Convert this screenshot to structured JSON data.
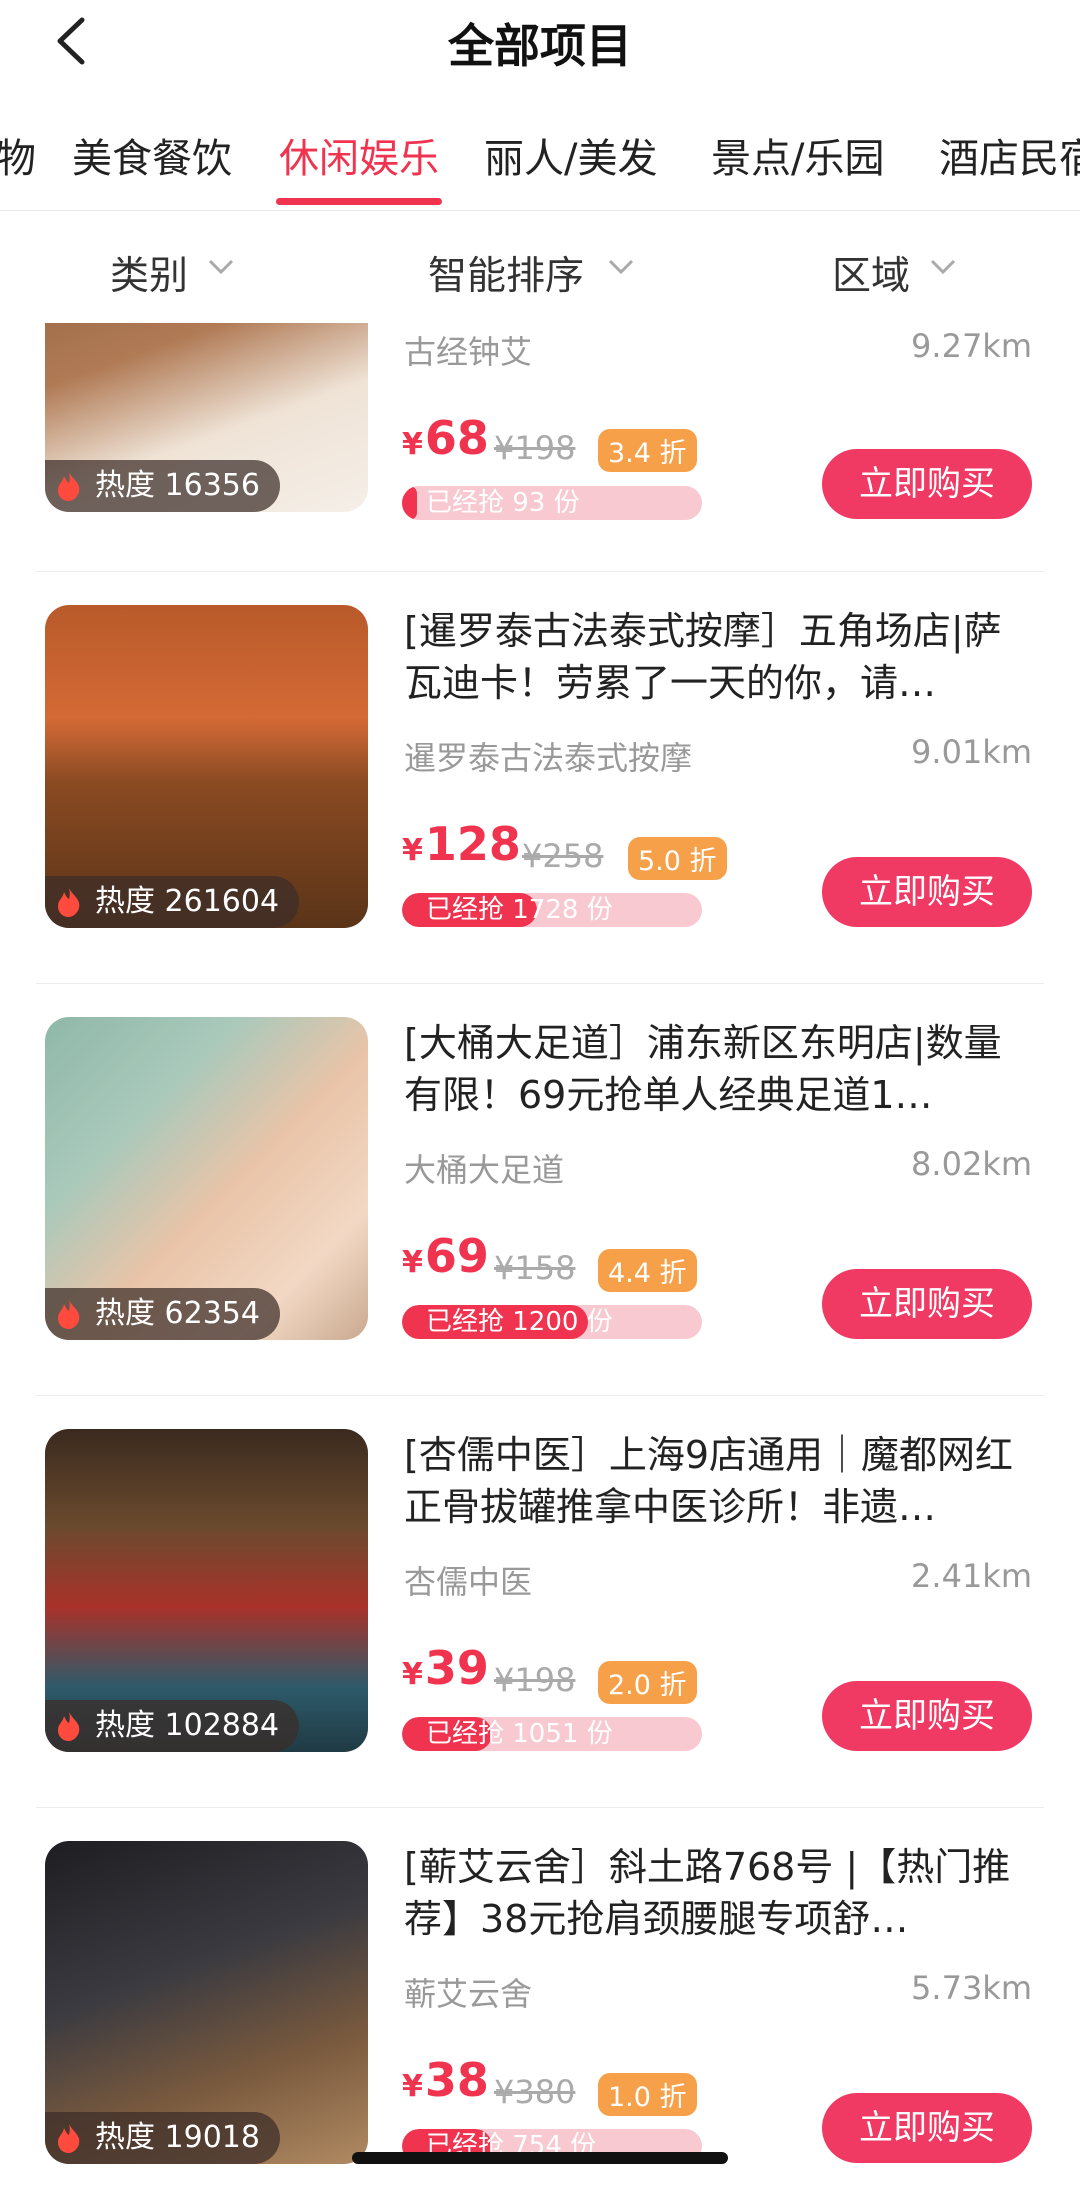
{
  "header": {
    "title": "全部项目"
  },
  "tabs": [
    "物",
    "美食餐饮",
    "休闲娱乐",
    "丽人/美发",
    "景点/乐园",
    "酒店民宿"
  ],
  "active_tab": "休闲娱乐",
  "filters": [
    "类别",
    "智能排序",
    "区域"
  ],
  "items": [
    {
      "title": "",
      "shop": "古经钟艾",
      "distance": "9.27km",
      "price": "68",
      "original": "¥198",
      "discount": "3.4 折",
      "sold": "已经抢 93 份",
      "sold_fraction": 0.05,
      "heat": "热度 16356",
      "buy": "立即购买"
    },
    {
      "title": "[暹罗泰古法泰式按摩］五角场店|萨瓦迪卡！劳累了一天的你，请…",
      "shop": "暹罗泰古法泰式按摩",
      "distance": "9.01km",
      "price": "128",
      "original": "¥258",
      "discount": "5.0 折",
      "sold": "已经抢 1728 份",
      "sold_fraction": 0.45,
      "heat": "热度 261604",
      "buy": "立即购买"
    },
    {
      "title": "[大桶大足道］浦东新区东明店|数量有限！69元抢单人经典足道1…",
      "shop": "大桶大足道",
      "distance": "8.02km",
      "price": "69",
      "original": "¥158",
      "discount": "4.4 折",
      "sold": "已经抢 1200 份",
      "sold_fraction": 0.62,
      "heat": "热度 62354",
      "buy": "立即购买"
    },
    {
      "title": "[杏儒中医］上海9店通用｜魔都网红正骨拔罐推拿中医诊所！非遗…",
      "shop": "杏儒中医",
      "distance": "2.41km",
      "price": "39",
      "original": "¥198",
      "discount": "2.0 折",
      "sold": "已经抢 1051 份",
      "sold_fraction": 0.3,
      "heat": "热度 102884",
      "buy": "立即购买"
    },
    {
      "title": "[蕲艾云舍］斜土路768号 |【热门推荐】38元抢肩颈腰腿专项舒…",
      "shop": "蕲艾云舍",
      "distance": "5.73km",
      "price": "38",
      "original": "¥380",
      "discount": "1.0 折",
      "sold": "已经抢 754 份",
      "sold_fraction": 0.3,
      "heat": "热度 19018",
      "buy": "立即购买"
    }
  ]
}
